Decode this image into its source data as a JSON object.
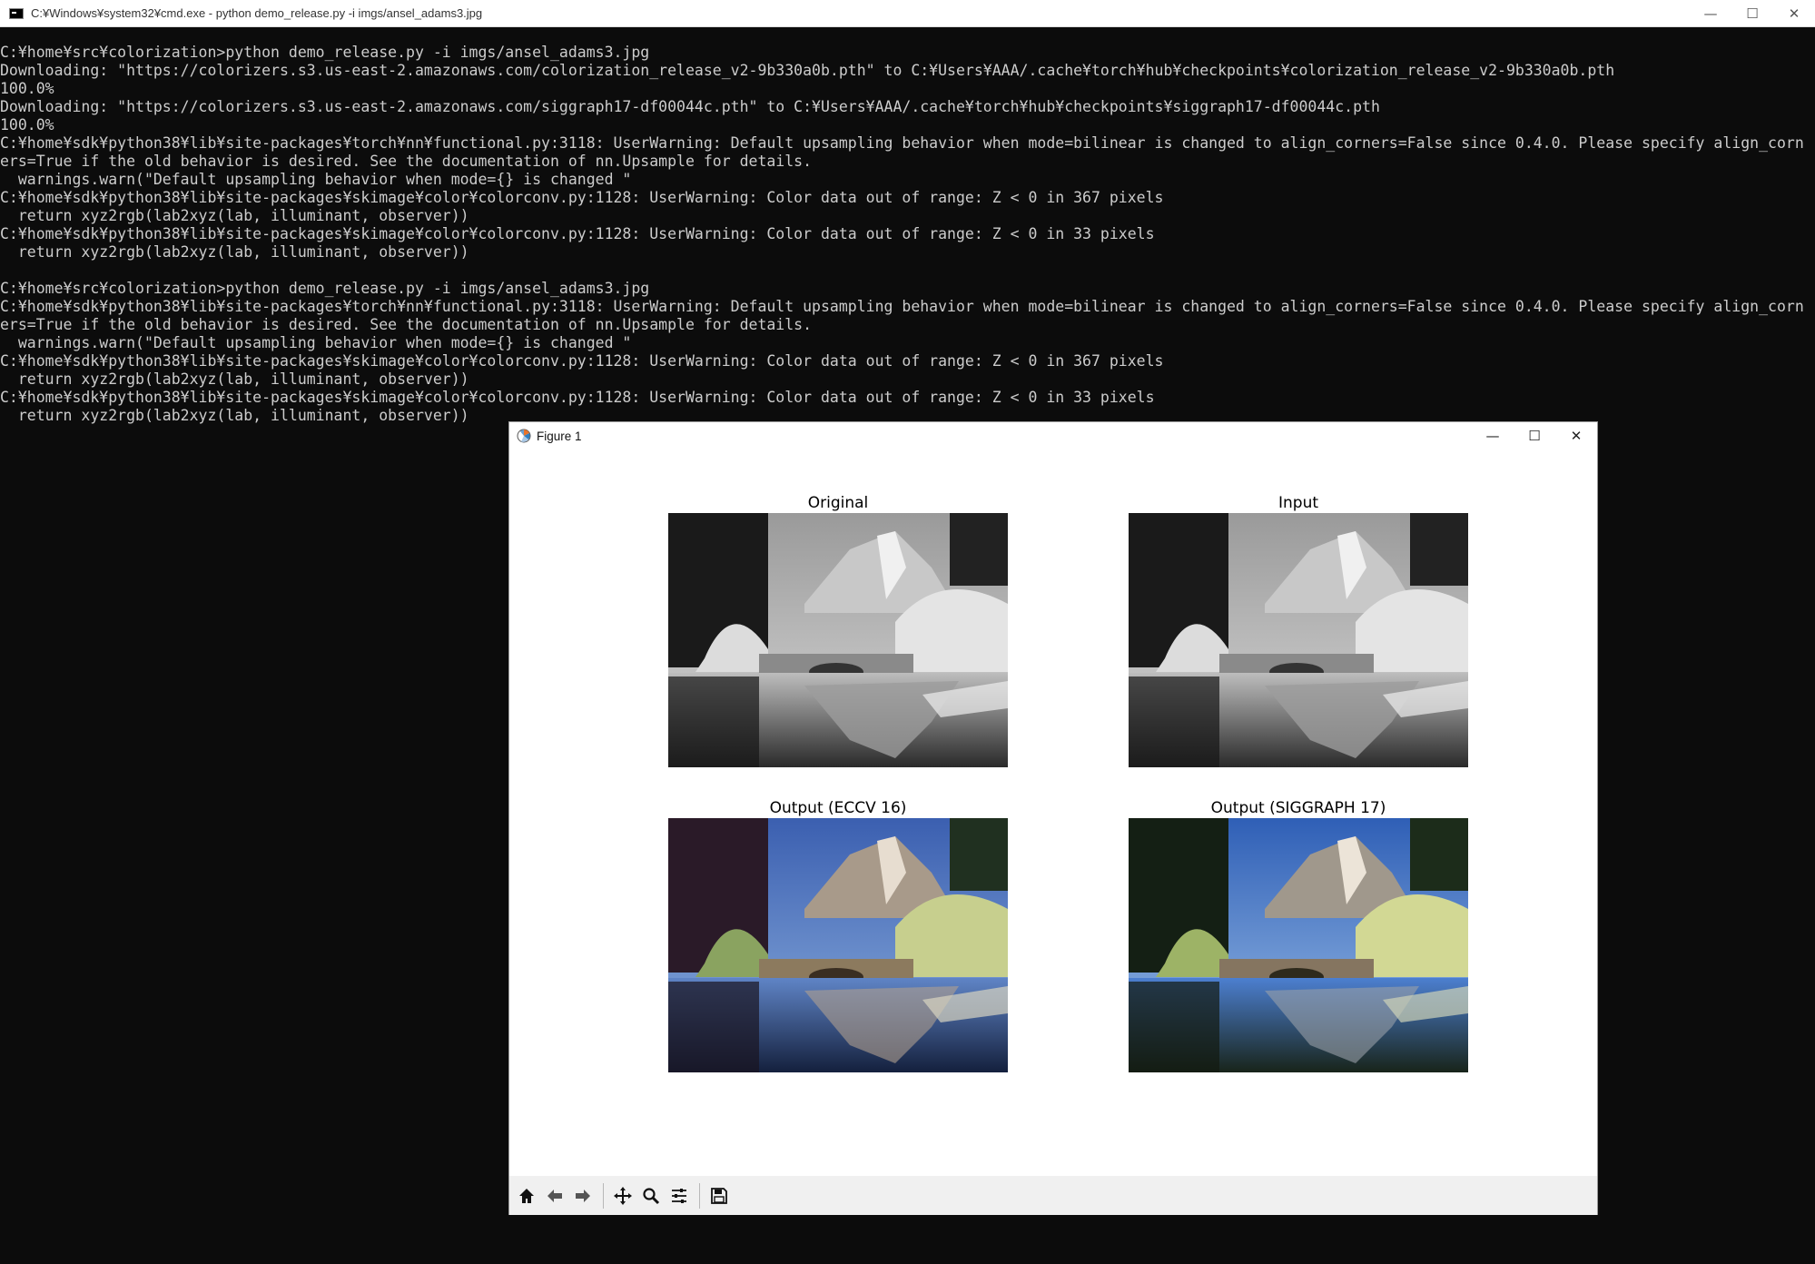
{
  "console": {
    "title": "C:¥Windows¥system32¥cmd.exe - python  demo_release.py -i imgs/ansel_adams3.jpg",
    "lines": [
      "C:¥home¥src¥colorization>python demo_release.py -i imgs/ansel_adams3.jpg",
      "Downloading: \"https://colorizers.s3.us-east-2.amazonaws.com/colorization_release_v2-9b330a0b.pth\" to C:¥Users¥AAA/.cache¥torch¥hub¥checkpoints¥colorization_release_v2-9b330a0b.pth",
      "100.0%",
      "Downloading: \"https://colorizers.s3.us-east-2.amazonaws.com/siggraph17-df00044c.pth\" to C:¥Users¥AAA/.cache¥torch¥hub¥checkpoints¥siggraph17-df00044c.pth",
      "100.0%",
      "C:¥home¥sdk¥python38¥lib¥site-packages¥torch¥nn¥functional.py:3118: UserWarning: Default upsampling behavior when mode=bilinear is changed to align_corners=False since 0.4.0. Please specify align_corn",
      "ers=True if the old behavior is desired. See the documentation of nn.Upsample for details.",
      "  warnings.warn(\"Default upsampling behavior when mode={} is changed \"",
      "C:¥home¥sdk¥python38¥lib¥site-packages¥skimage¥color¥colorconv.py:1128: UserWarning: Color data out of range: Z < 0 in 367 pixels",
      "  return xyz2rgb(lab2xyz(lab, illuminant, observer))",
      "C:¥home¥sdk¥python38¥lib¥site-packages¥skimage¥color¥colorconv.py:1128: UserWarning: Color data out of range: Z < 0 in 33 pixels",
      "  return xyz2rgb(lab2xyz(lab, illuminant, observer))",
      "",
      "C:¥home¥src¥colorization>python demo_release.py -i imgs/ansel_adams3.jpg",
      "C:¥home¥sdk¥python38¥lib¥site-packages¥torch¥nn¥functional.py:3118: UserWarning: Default upsampling behavior when mode=bilinear is changed to align_corners=False since 0.4.0. Please specify align_corn",
      "ers=True if the old behavior is desired. See the documentation of nn.Upsample for details.",
      "  warnings.warn(\"Default upsampling behavior when mode={} is changed \"",
      "C:¥home¥sdk¥python38¥lib¥site-packages¥skimage¥color¥colorconv.py:1128: UserWarning: Color data out of range: Z < 0 in 367 pixels",
      "  return xyz2rgb(lab2xyz(lab, illuminant, observer))",
      "C:¥home¥sdk¥python38¥lib¥site-packages¥skimage¥color¥colorconv.py:1128: UserWarning: Color data out of range: Z < 0 in 33 pixels",
      "  return xyz2rgb(lab2xyz(lab, illuminant, observer))"
    ]
  },
  "figure": {
    "title": "Figure 1",
    "panels": [
      {
        "title": "Original",
        "style": "grayscale"
      },
      {
        "title": "Input",
        "style": "grayscale"
      },
      {
        "title": "Output (ECCV 16)",
        "style": "color-eccv"
      },
      {
        "title": "Output (SIGGRAPH 17)",
        "style": "color-siggraph"
      }
    ],
    "toolbar": [
      "home-icon",
      "back-icon",
      "forward-icon",
      "pan-icon",
      "zoom-icon",
      "configure-subplots-icon",
      "save-icon"
    ]
  },
  "window_controls": {
    "minimize": "—",
    "maximize": "☐",
    "close": "✕"
  }
}
